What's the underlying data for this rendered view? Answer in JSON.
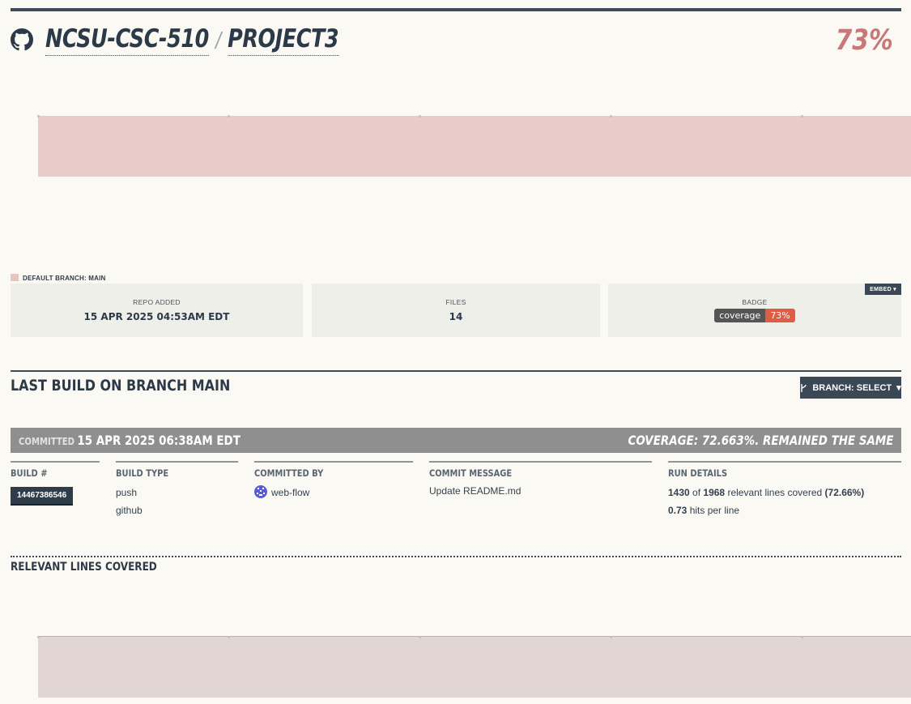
{
  "header": {
    "owner": "NCSU-CSC-510",
    "separator": "/",
    "repo": "PROJECT3",
    "coverage_percent": "73%"
  },
  "legend": {
    "label": "DEFAULT BRANCH: MAIN"
  },
  "stats": {
    "repo_added_label": "REPO ADDED",
    "repo_added_value": "15 APR 2025 04:53AM EDT",
    "files_label": "FILES",
    "files_value": "14",
    "badge_label": "BADGE",
    "badge_left": "coverage",
    "badge_right": "73%",
    "embed_label": "EMBED"
  },
  "build": {
    "title": "LAST BUILD ON BRANCH MAIN",
    "branch_button": "BRANCH: SELECT",
    "committed_prefix": "COMMITTED",
    "committed_date": "15 APR 2025 06:38AM EDT",
    "coverage_summary": "COVERAGE: 72.663%. REMAINED THE SAME",
    "columns": {
      "build_num_header": "BUILD #",
      "build_num": "14467386546",
      "build_type_header": "BUILD TYPE",
      "build_type_1": "push",
      "build_type_2": "github",
      "committed_by_header": "COMMITTED BY",
      "committed_by": "web-flow",
      "commit_message_header": "COMMIT MESSAGE",
      "commit_message": "Update README.md",
      "run_details_header": "RUN DETAILS",
      "lines_covered": "1430",
      "lines_of": "of",
      "lines_total": "1968",
      "lines_text": "relevant lines covered",
      "lines_pct": "(72.66%)",
      "hits": "0.73",
      "hits_text": "hits per line"
    }
  },
  "relevant_lines": {
    "title": "RELEVANT LINES COVERED"
  },
  "colors": {
    "accent": "#c87878",
    "dark": "#3a4754",
    "chart_fill": "#e9cbc7",
    "badge_red": "#e05d44"
  }
}
